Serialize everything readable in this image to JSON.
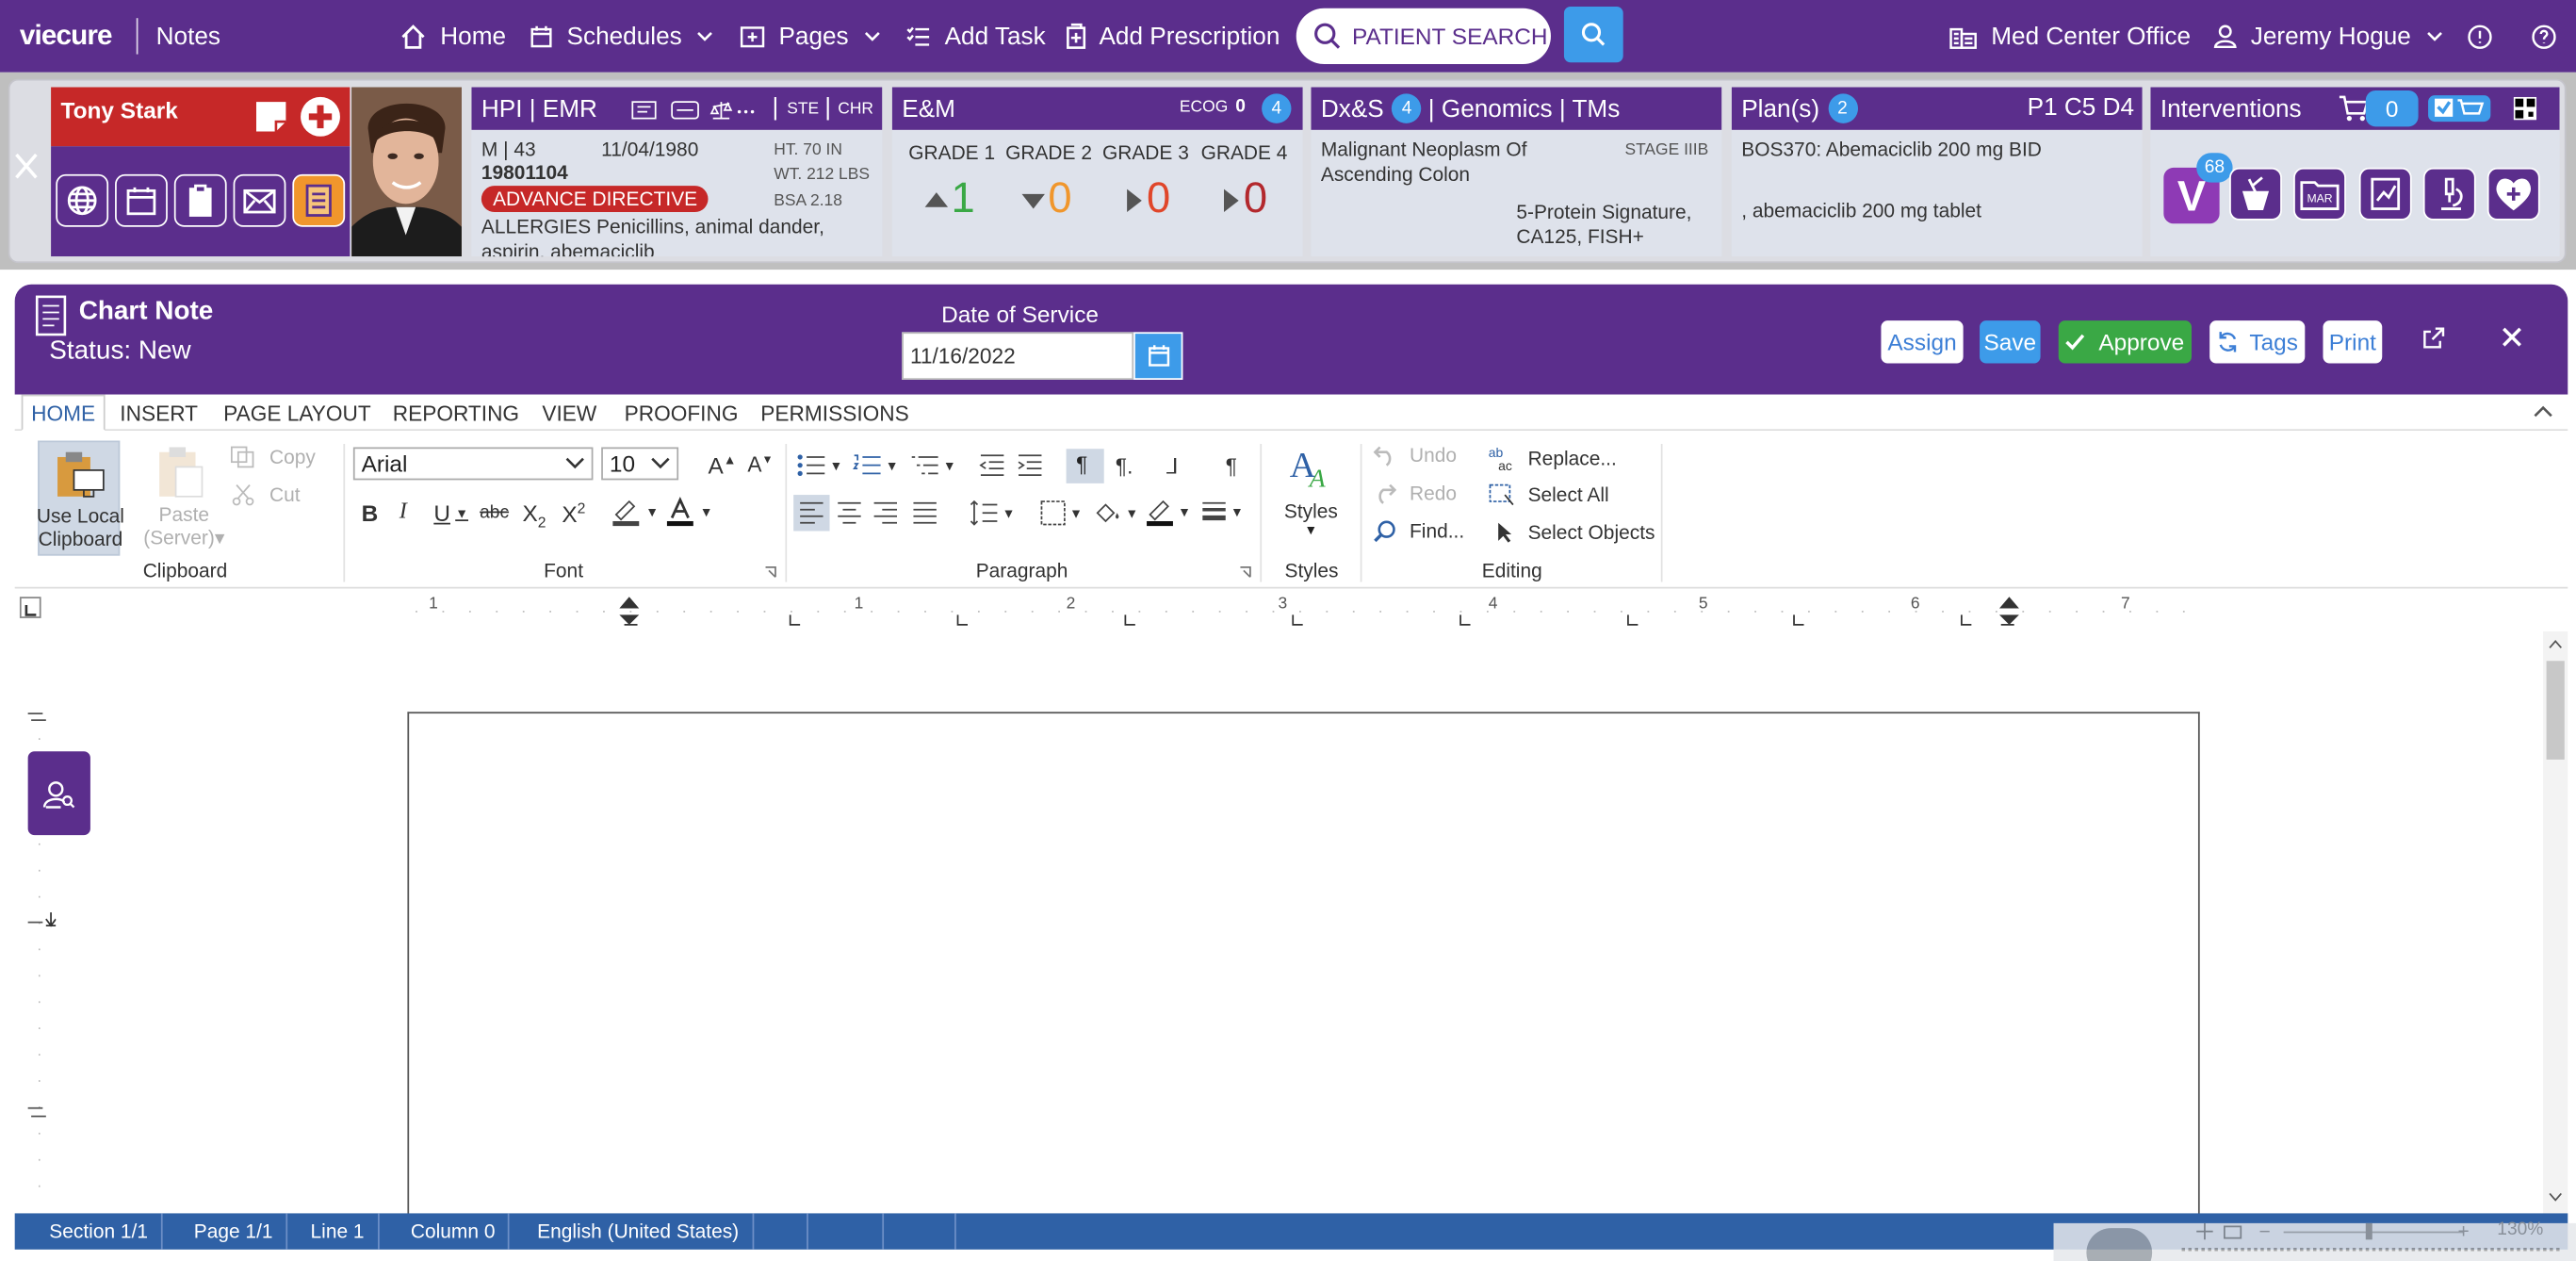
{
  "nav": {
    "logo": "viecure",
    "module": "Notes",
    "home": "Home",
    "schedules": "Schedules",
    "pages": "Pages",
    "add_task": "Add Task",
    "add_prescription": "Add Prescription",
    "search_placeholder": "PATIENT SEARCH",
    "office": "Med Center Office",
    "user": "Jeremy Hogue"
  },
  "patient": {
    "name": "Tony Stark",
    "sex_age": "M | 43",
    "dob": "11/04/1980",
    "mrn": "19801104",
    "advance_directive": "ADVANCE DIRECTIVE",
    "allergies": "ALLERGIES Penicillins, animal dander, aspirin, abemaciclib",
    "height": "HT. 70 IN",
    "weight": "WT. 212 LBS",
    "bsa": "BSA 2.18"
  },
  "hpi": {
    "title": "HPI | EMR",
    "ste": "STE",
    "chr": "CHR"
  },
  "em": {
    "title": "E&M",
    "ecog_label": "ECOG",
    "ecog_value": "0",
    "badge": "4",
    "grades": [
      {
        "label": "GRADE 1",
        "value": "1",
        "color": "#3aa845"
      },
      {
        "label": "GRADE 2",
        "value": "0",
        "color": "#f0962c"
      },
      {
        "label": "GRADE 3",
        "value": "0",
        "color": "#e0462a"
      },
      {
        "label": "GRADE 4",
        "value": "0",
        "color": "#b3282d"
      }
    ]
  },
  "dx": {
    "title_a": "Dx&S",
    "badge": "4",
    "title_b": "| Genomics | TMs",
    "diagnosis": "Malignant Neoplasm Of Ascending Colon",
    "stage": "STAGE IIIB",
    "markers": "5-Protein Signature, CA125, FISH+"
  },
  "plan": {
    "title": "Plan(s)",
    "badge": "2",
    "cycle": "P1 C5 D4",
    "line1": "BOS370: Abemaciclib 200 mg BID",
    "line2": ", abemaciclib 200 mg tablet"
  },
  "interventions": {
    "title": "Interventions",
    "cart_count": "0",
    "v_badge": "68",
    "mar": "MAR"
  },
  "chartnote": {
    "title": "Chart Note",
    "status": "Status: New",
    "dos_label": "Date of Service",
    "dos_value": "11/16/2022",
    "assign": "Assign",
    "save": "Save",
    "approve": "Approve",
    "tags": "Tags",
    "print": "Print"
  },
  "ribbon": {
    "tabs": [
      "HOME",
      "INSERT",
      "PAGE LAYOUT",
      "REPORTING",
      "VIEW",
      "PROOFING",
      "PERMISSIONS"
    ],
    "use_local_1": "Use Local",
    "use_local_2": "Clipboard",
    "paste_1": "Paste",
    "paste_2": "(Server)",
    "copy": "Copy",
    "cut": "Cut",
    "clipboard": "Clipboard",
    "font_name": "Arial",
    "font_size": "10",
    "font": "Font",
    "paragraph": "Paragraph",
    "styles_btn": "Styles",
    "styles": "Styles",
    "undo": "Undo",
    "redo": "Redo",
    "find": "Find...",
    "replace": "Replace...",
    "select_all": "Select All",
    "select_objects": "Select Objects",
    "editing": "Editing"
  },
  "ruler": {
    "marks": [
      "1",
      "1",
      "2",
      "3",
      "4",
      "5",
      "6",
      "7"
    ]
  },
  "statusbar": {
    "section": "Section 1/1",
    "page": "Page 1/1",
    "line": "Line 1",
    "column": "Column 0",
    "language": "English (United States)",
    "zoom": "130%"
  },
  "colors": {
    "brand": "#5b2e8c",
    "accent": "#3d9be9",
    "approve": "#3aa845",
    "alert": "#c62828"
  }
}
